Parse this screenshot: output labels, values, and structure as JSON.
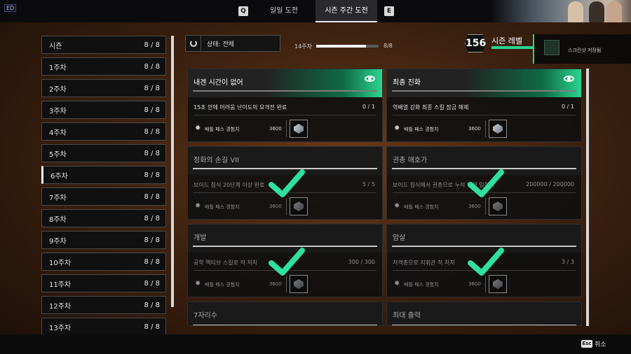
{
  "topbar": {
    "corner_badge": "ED",
    "tab_left_key": "Q",
    "tab_right_key": "E",
    "tabs": [
      {
        "label": "일일 도전",
        "active": false
      },
      {
        "label": "시즌 주간 도전",
        "active": true
      }
    ]
  },
  "sidebar": {
    "items": [
      {
        "label": "시즌",
        "count": "8 / 8"
      },
      {
        "label": "1주차",
        "count": "8 / 8"
      },
      {
        "label": "2주차",
        "count": "8 / 8"
      },
      {
        "label": "3주차",
        "count": "8 / 8"
      },
      {
        "label": "4주차",
        "count": "8 / 8"
      },
      {
        "label": "5주차",
        "count": "8 / 8"
      },
      {
        "label": "6주차",
        "count": "8 / 8",
        "selected": true
      },
      {
        "label": "7주차",
        "count": "8 / 8"
      },
      {
        "label": "8주차",
        "count": "8 / 8"
      },
      {
        "label": "9주차",
        "count": "8 / 8"
      },
      {
        "label": "10주차",
        "count": "8 / 8"
      },
      {
        "label": "11주차",
        "count": "8 / 8"
      },
      {
        "label": "12주차",
        "count": "8 / 8"
      },
      {
        "label": "13주차",
        "count": "8 / 8"
      }
    ]
  },
  "filter": {
    "label": "상태: 전체"
  },
  "week": {
    "label": "14주차",
    "count": "8/8",
    "progress": 0.8
  },
  "season": {
    "level": "156",
    "title": "시즌 레벨"
  },
  "notice": {
    "line1": "",
    "line2": "스크린샷 저장됨"
  },
  "cards": [
    {
      "title": "내겐 시간이 없어",
      "desc": "15초 안에 어려움 난이도의 요격전 완료",
      "progress": "0 / 1",
      "reward_label": "배틀 패스 경험치",
      "reward_value": "3600",
      "active": true,
      "done": false
    },
    {
      "title": "최종 진화",
      "desc": "역배열 강화 최종 스킬 잠금 해제",
      "progress": "0 / 1",
      "reward_label": "배틀 패스 경험치",
      "reward_value": "3600",
      "active": true,
      "done": false
    },
    {
      "title": "정화의 손길 VII",
      "desc": "보이드 침식 20단계 이상 완료",
      "progress": "5 / 5",
      "reward_label": "배틀 패스 경험치",
      "reward_value": "3600",
      "active": false,
      "done": true
    },
    {
      "title": "권총 애호가",
      "desc": "보이드 침식에서 권총으로 누적 피해 입히기",
      "progress": "200000 / 200000",
      "reward_label": "배틀 패스 경험치",
      "reward_value": "3600",
      "active": false,
      "done": true
    },
    {
      "title": "개발",
      "desc": "공학 액티브 스킬로 적 처치",
      "progress": "300 / 300",
      "reward_label": "배틀 패스 경험치",
      "reward_value": "3600",
      "active": false,
      "done": true
    },
    {
      "title": "암살",
      "desc": "저격총으로 지휘관 적 처치",
      "progress": "3 / 3",
      "reward_label": "배틀 패스 경험치",
      "reward_value": "3600",
      "active": false,
      "done": true
    },
    {
      "title": "7자리수",
      "active": false,
      "done": true
    },
    {
      "title": "최대 출력",
      "active": false,
      "done": true
    }
  ],
  "bottombar": {
    "key": "Esc",
    "cancel_label": "취소"
  },
  "colors": {
    "accent": "#2bd58f",
    "check": "#2fe0a0"
  }
}
